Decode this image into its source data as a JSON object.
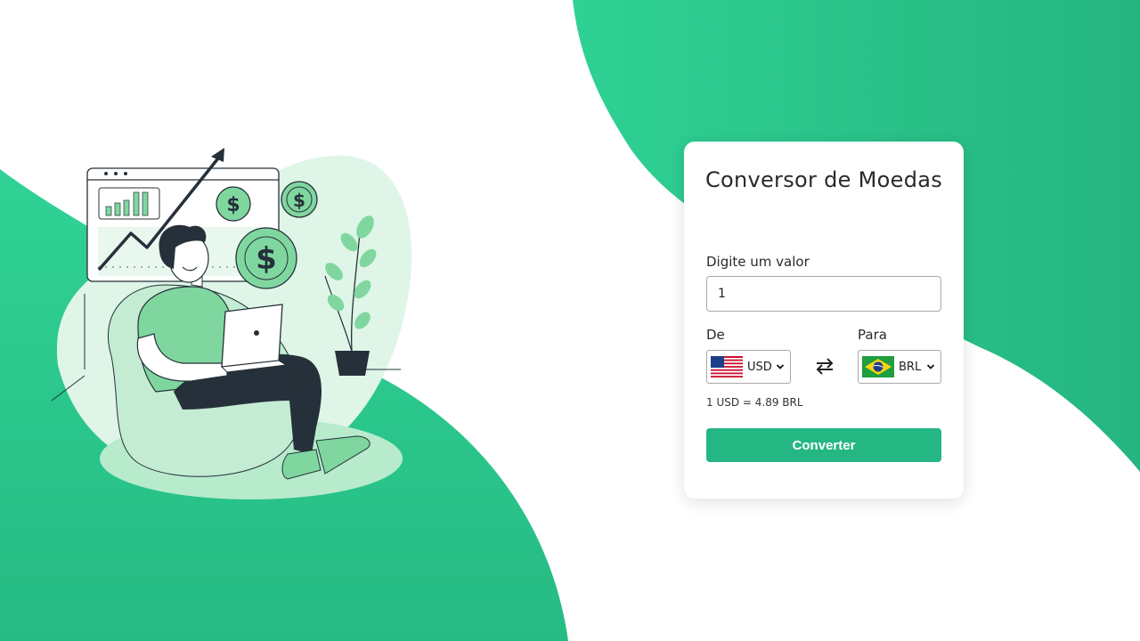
{
  "converter": {
    "title": "Conversor de Moedas",
    "amount_label": "Digite um valor",
    "amount_value": "1",
    "from_label": "De",
    "to_label": "Para",
    "from_currency": {
      "code": "USD",
      "flag": "us-flag-icon",
      "options": [
        "USD"
      ]
    },
    "to_currency": {
      "code": "BRL",
      "flag": "br-flag-icon",
      "options": [
        "BRL"
      ]
    },
    "swap_icon": "swap-arrows-icon",
    "rate_text": "1 USD = 4.89 BRL",
    "convert_label": "Converter"
  },
  "colors": {
    "accent": "#25b783",
    "background_wave": "#2ecf94",
    "card": "#ffffff"
  },
  "illustration": {
    "subject": "man-with-laptop-finance-illustration",
    "coin_symbol": "$"
  }
}
